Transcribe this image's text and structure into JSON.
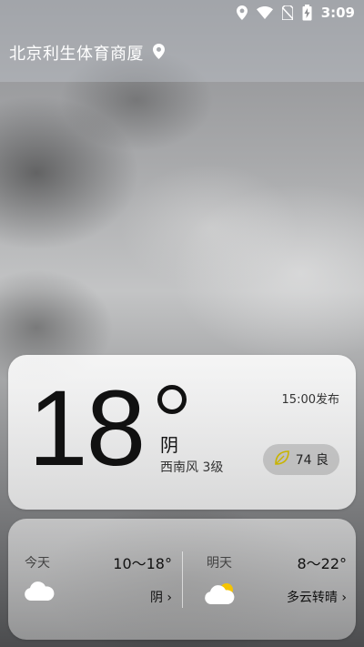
{
  "status_bar": {
    "time": "3:09",
    "icons": [
      "location-icon",
      "wifi-icon",
      "no-sim-icon",
      "battery-charging-icon"
    ]
  },
  "location": {
    "name": "北京利生体育商厦",
    "icon": "map-pin-icon"
  },
  "current": {
    "temperature": "18",
    "condition": "阴",
    "wind": "西南风 3级",
    "published": "15:00发布",
    "aqi": {
      "value": "74",
      "label": "良",
      "text": "74 良",
      "icon": "leaf-icon"
    }
  },
  "forecast": [
    {
      "day": "今天",
      "range": "10～18°",
      "condition": "阴 ›",
      "icon": "cloud-icon"
    },
    {
      "day": "明天",
      "range": "8～22°",
      "condition": "多云转晴 ›",
      "icon": "partly-cloudy-icon"
    }
  ],
  "colors": {
    "text_dark": "#111111",
    "white": "#ffffff",
    "aqi_leaf": "#c8b400",
    "sun": "#f5c400"
  }
}
